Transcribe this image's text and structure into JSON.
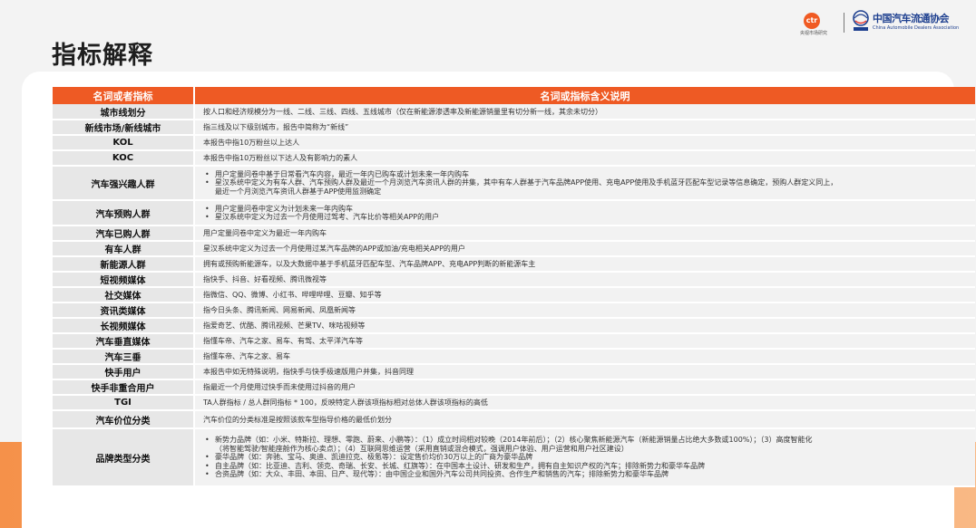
{
  "header": {
    "title": "指标解释",
    "ctr_logo_text": "ctr",
    "ctr_caption": "央视市场研究",
    "cada_name": "中国汽车流通协会",
    "cada_english": "China Automobile Dealers Association"
  },
  "colors": {
    "accent": "#ee5a24",
    "term_bg": "#e7e7e7",
    "desc_bg": "#f2f2f2",
    "brand_blue": "#1d3f8f"
  },
  "table": {
    "headers": [
      "名词或者指标",
      "名词或指标含义说明"
    ],
    "rows": [
      {
        "term": "城市线划分",
        "h": 17,
        "lines": [
          {
            "text": "按人口和经济规模分为一线、二线、三线、四线、五线城市（仅在新能源渗透率及新能源销量里有切分新一线，其余未切分）",
            "bullet": false
          }
        ]
      },
      {
        "term": "新线市场/新线城市",
        "h": 17,
        "lines": [
          {
            "text": "指三线及以下级别城市，报告中简称为“新线”",
            "bullet": false
          }
        ]
      },
      {
        "term": "KOL",
        "h": 17,
        "lines": [
          {
            "text": "本报告中指10万粉丝以上达人",
            "bullet": false
          }
        ]
      },
      {
        "term": "KOC",
        "h": 17,
        "lines": [
          {
            "text": "本报告中指10万粉丝以下达人及有影响力的素人",
            "bullet": false
          }
        ]
      },
      {
        "term": "汽车强兴趣人群",
        "h": 38,
        "lines": [
          {
            "text": "用户定量问卷中基于日常看汽车内容，最近一年内已购车或计划未来一年内购车",
            "bullet": true
          },
          {
            "text": "星汉系统中定义为有车人群、汽车预购人群及最近一个月浏览汽车资讯人群的并集，其中有车人群基于汽车品牌APP使用、充电APP使用及手机蓝牙匹配车型记录等信息确定，预购人群定义同上，",
            "bullet": true
          },
          {
            "text": "最近一个月浏览汽车资讯人群基于APP使用监测确定",
            "bullet": false
          }
        ]
      },
      {
        "term": "汽车预购人群",
        "h": 28,
        "lines": [
          {
            "text": "用户定量问卷中定义为计划未来一年内购车",
            "bullet": true
          },
          {
            "text": "星汉系统中定义为过去一个月使用过驾考、汽车比价等相关APP的用户",
            "bullet": true
          }
        ]
      },
      {
        "term": "汽车已购人群",
        "h": 17,
        "lines": [
          {
            "text": "用户定量问卷中定义为最近一年内购车",
            "bullet": false
          }
        ]
      },
      {
        "term": "有车人群",
        "h": 17,
        "lines": [
          {
            "text": "星汉系统中定义为过去一个月使用过某汽车品牌的APP或加油/充电相关APP的用户",
            "bullet": false
          }
        ]
      },
      {
        "term": "新能源人群",
        "h": 17,
        "lines": [
          {
            "text": "拥有或预购新能源车，以及大数据中基于手机蓝牙匹配车型、汽车品牌APP、充电APP判断的新能源车主",
            "bullet": false
          }
        ]
      },
      {
        "term": "短视频媒体",
        "h": 17,
        "lines": [
          {
            "text": "指快手、抖音、好看视频、腾讯微视等",
            "bullet": false
          }
        ]
      },
      {
        "term": "社交媒体",
        "h": 17,
        "lines": [
          {
            "text": "指微信、QQ、微博、小红书、哔哩哔哩、豆瓣、知乎等",
            "bullet": false
          }
        ]
      },
      {
        "term": "资讯类媒体",
        "h": 17,
        "lines": [
          {
            "text": "指今日头条、腾讯新闻、网易新闻、凤凰新闻等",
            "bullet": false
          }
        ]
      },
      {
        "term": "长视频媒体",
        "h": 17,
        "lines": [
          {
            "text": "指爱奇艺、优酷、腾讯视频、芒果TV、咪咕视频等",
            "bullet": false
          }
        ]
      },
      {
        "term": "汽车垂直媒体",
        "h": 17,
        "lines": [
          {
            "text": "指懂车帝、汽车之家、易车、有驾、太平洋汽车等",
            "bullet": false
          }
        ]
      },
      {
        "term": "汽车三垂",
        "h": 17,
        "lines": [
          {
            "text": "指懂车帝、汽车之家、易车",
            "bullet": false
          }
        ]
      },
      {
        "term": "快手用户",
        "h": 17,
        "lines": [
          {
            "text": "本报告中如无特殊说明，指快手与快手极速版用户并集，抖音同理",
            "bullet": false
          }
        ]
      },
      {
        "term": "快手非重合用户",
        "h": 17,
        "lines": [
          {
            "text": "指最近一个月使用过快手而未使用过抖音的用户",
            "bullet": false
          }
        ]
      },
      {
        "term": "TGI",
        "h": 17,
        "lines": [
          {
            "text": "TA人群指标 / 总人群同指标 * 100，反映特定人群该项指标相对总体人群该项指标的高低",
            "bullet": false
          }
        ]
      },
      {
        "term": "汽车价位分类",
        "h": 20,
        "lines": [
          {
            "text": "汽车价位的分类标准是按照该款车型指导价格的最低价划分",
            "bullet": false
          }
        ]
      },
      {
        "term": "品牌类型分类",
        "h": 64,
        "lines": [
          {
            "text": "新势力品牌（如：小米、特斯拉、理想、零跑、蔚来、小鹏等）：（1）成立时间相对较晚（2014年前后）；（2）核心聚焦新能源汽车（新能源销量占比绝大多数或100%）；（3）高度智能化",
            "bullet": true
          },
          {
            "text": "（将智能驾驶/智能座舱作为核心卖点）；（4）互联网思维运营（采用直销或混合模式，强调用户体验、用户运营和用户社区建设）",
            "bullet": false
          },
          {
            "text": "豪华品牌（如：奔驰、宝马、奥迪、凯迪拉克、极氪等）：设定售价均价30万以上的广商为豪华品牌",
            "bullet": true
          },
          {
            "text": "自主品牌（如：比亚迪、吉利、领克、奇瑞、长安、长城、红旗等）：在中国本土设计、研发和生产，拥有自主知识产权的汽车；排除新势力和豪华车品牌",
            "bullet": true
          },
          {
            "text": "合资品牌（如：大众、丰田、本田、日产、现代等）：由中国企业和国外汽车公司共同投资、合作生产和销售的汽车；排除新势力和豪华车品牌",
            "bullet": true
          }
        ]
      }
    ]
  }
}
